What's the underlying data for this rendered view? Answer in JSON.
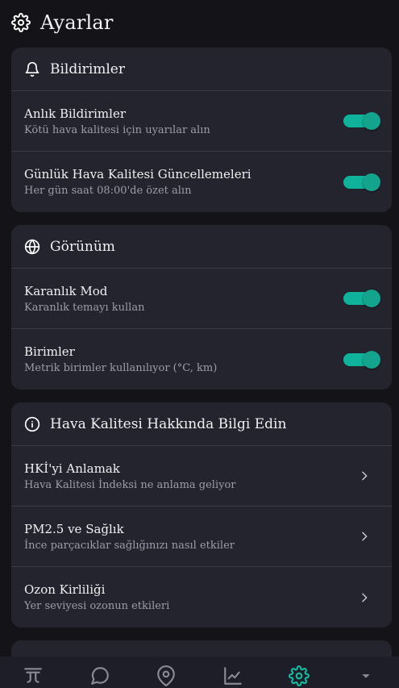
{
  "header": {
    "title": "Ayarlar"
  },
  "cards": {
    "notifications": {
      "title": "Bildirimler",
      "rows": [
        {
          "title": "Anlık Bildirimler",
          "subtitle": "Kötü hava kalitesi için uyarılar alın",
          "on": true
        },
        {
          "title": "Günlük Hava Kalitesi Güncellemeleri",
          "subtitle": "Her gün saat 08:00'de özet alın",
          "on": true
        }
      ]
    },
    "appearance": {
      "title": "Görünüm",
      "rows": [
        {
          "title": "Karanlık Mod",
          "subtitle": "Karanlık temayı kullan",
          "on": true
        },
        {
          "title": "Birimler",
          "subtitle": "Metrik birimler kullanılıyor (°C, km)",
          "on": true
        }
      ]
    },
    "learn": {
      "title": "Hava Kalitesi Hakkında Bilgi Edin",
      "rows": [
        {
          "title": "HKİ'yi Anlamak",
          "subtitle": "Hava Kalitesi İndeksi ne anlama geliyor"
        },
        {
          "title": "PM2.5 ve Sağlık",
          "subtitle": "İnce parçacıklar sağlığınızı nasıl etkiler"
        },
        {
          "title": "Ozon Kirliliği",
          "subtitle": "Yer seviyesi ozonun etkileri"
        }
      ]
    }
  },
  "colors": {
    "accent": "#14a38c",
    "card": "#24242f",
    "background": "#131318"
  },
  "nav": {
    "items": [
      {
        "icon": "air-icon"
      },
      {
        "icon": "chat-icon"
      },
      {
        "icon": "location-icon"
      },
      {
        "icon": "chart-icon"
      },
      {
        "icon": "settings-icon",
        "active": true
      },
      {
        "icon": "chevron-down-icon"
      }
    ]
  }
}
